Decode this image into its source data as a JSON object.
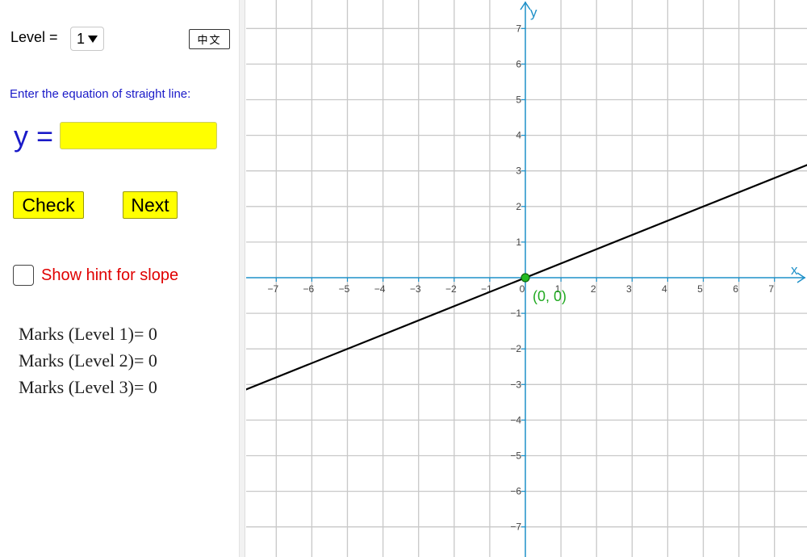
{
  "panel": {
    "level_label": "Level =",
    "level_value": "1",
    "lang_button": "中文",
    "instruction": "Enter the equation of straight line:",
    "y_label": "y =",
    "answer_value": "",
    "check_label": "Check",
    "next_label": "Next",
    "hint_label": "Show hint for slope",
    "marks": [
      "Marks (Level 1)= 0",
      "Marks (Level 2)= 0",
      "Marks (Level 3)= 0"
    ]
  },
  "graph": {
    "x_axis_label": "x",
    "y_axis_label": "y",
    "x_range": [
      -8,
      8
    ],
    "y_range": [
      -8,
      8
    ],
    "x_ticks": [
      -7,
      -6,
      -5,
      -4,
      -3,
      -2,
      -1,
      0,
      1,
      2,
      3,
      4,
      5,
      6,
      7
    ],
    "y_ticks": [
      -7,
      -6,
      -5,
      -4,
      -3,
      -2,
      -1,
      1,
      2,
      3,
      4,
      5,
      6,
      7
    ],
    "line": {
      "slope": 0.4,
      "intercept": 0
    },
    "point": {
      "x": 0,
      "y": 0,
      "label": "(0, 0)"
    },
    "colors": {
      "axis": "#1e90c8",
      "grid": "#c8c8c8",
      "line": "#000000",
      "point": "#22bb22",
      "point_label": "#22aa22"
    }
  }
}
